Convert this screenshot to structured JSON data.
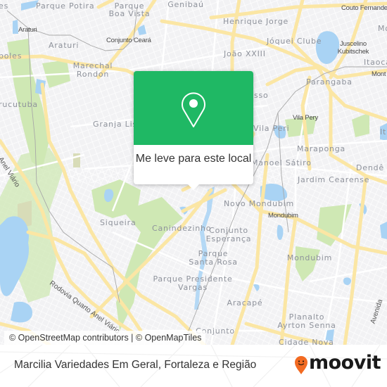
{
  "map": {
    "colors": {
      "background": "#f2f2f4",
      "major_road": "#fbe6a4",
      "minor_road": "#ffffff",
      "water": "#a9d3f4",
      "park": "#cfe8b4",
      "rail": "#a8a8a8"
    },
    "neighborhood_labels": [
      "Parque Potira",
      "Parque",
      "Boa Vista",
      "Genibaú",
      "Henrique Jorge",
      "Jóquei Clube",
      "Araturi",
      "João XXIII",
      "Marechal",
      "Rondon",
      "Itaoca",
      "Mo",
      "poles",
      "es",
      "rucutuba",
      "Granja Lisboa",
      "sso",
      "Parangaba",
      "Vila Peri",
      "Maraponga",
      "Manoel Sátiro",
      "Dendê",
      "It",
      "Jardim Cearense",
      "Novo Mondubim",
      "Siqueira",
      "Canindezinho",
      "Conjunto",
      "Esperança",
      "Parque",
      "Santa Rosa",
      "Mondubim",
      "Parque Presidente",
      "Vargas",
      "Aracapé",
      "Planalto",
      "Ayrton Senna",
      "Conjunto",
      "Cidade Nova"
    ],
    "poi_labels": [
      "Araturi",
      "Conjunto Ceará",
      "Couto Fernandes",
      "Juscelino",
      "Kubitschek",
      "Mont",
      "Vila Pery",
      "Mondubim"
    ],
    "road_labels": [
      "Anel Viário",
      "Rodovia Quarto Anel Viário",
      "Avenida"
    ]
  },
  "popup": {
    "icon": "map-pin-icon",
    "label": "Me leve para este local",
    "color": "#1fb864"
  },
  "attribution": "© OpenStreetMap contributors | © OpenMapTiles",
  "footer": {
    "title": "Marcilia Variedades Em Geral, Fortaleza e Região",
    "logo_text": "moovit",
    "logo_icon": "moovit-smiley-pin-icon",
    "logo_color": "#f26a21"
  }
}
